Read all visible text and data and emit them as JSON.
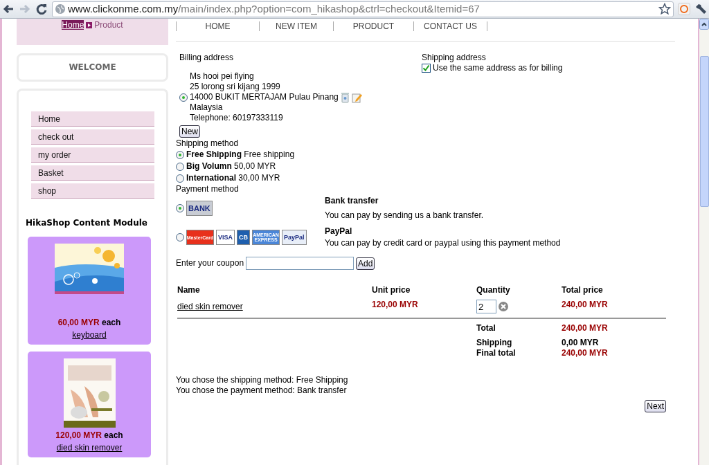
{
  "browser": {
    "url_host": "www.clickonme.com.my",
    "url_path": "/main/index.php?option=com_hikashop&ctrl=checkout&Itemid=67"
  },
  "breadcrumb": [
    {
      "label": "Home",
      "kind": "link"
    },
    {
      "label": "Product",
      "kind": "current"
    }
  ],
  "top_menu": [
    "HOME",
    "NEW ITEM",
    "PRODUCT",
    "CONTACT US"
  ],
  "sidebar": {
    "welcome": "WELCOME",
    "nav_items": [
      "Home",
      "check out",
      "my order",
      "Basket",
      "shop"
    ],
    "module_title": "HikaShop Content Module",
    "products": [
      {
        "price": "60,00 MYR",
        "unit": "each",
        "name": "keyboard",
        "kind": "flowers"
      },
      {
        "price": "120,00 MYR",
        "unit": "each",
        "name": "died skin remover",
        "kind": "leaflet"
      }
    ]
  },
  "billing": {
    "heading": "Billing address",
    "address": {
      "selected": true,
      "lines": [
        "Ms hooi pei flying",
        "25 lorong sri kijang 1999",
        "14000 BUKIT MERTAJAM Pulau Pinang",
        "Malaysia",
        "Telephone: 60197333119"
      ]
    },
    "new_button": "New"
  },
  "shipping_address": {
    "heading": "Shipping address",
    "same_as_billing": {
      "label": "Use the same address as for billing",
      "checked": true
    }
  },
  "shipping": {
    "heading": "Shipping method",
    "methods": [
      {
        "name": "Free Shipping",
        "detail": "Free shipping",
        "selected": true
      },
      {
        "name": "Big Volumn",
        "detail": "50,00 MYR",
        "selected": false
      },
      {
        "name": "International",
        "detail": "30,00 MYR",
        "selected": false
      }
    ]
  },
  "payment": {
    "heading": "Payment method",
    "methods": [
      {
        "title": "Bank transfer",
        "description": "You can pay by sending us a bank transfer.",
        "selected": true,
        "logos": [
          {
            "text": "BANK",
            "color": "#c8ccd4"
          }
        ]
      },
      {
        "title": "PayPal",
        "description": "You can pay by credit card or paypal using this payment method",
        "selected": false,
        "logos": [
          {
            "text": "MasterCard",
            "color": "#e8301c"
          },
          {
            "text": "VISA",
            "color": "#ffffff"
          },
          {
            "text": "CB",
            "color": "#1e5fae"
          },
          {
            "text": "AMERICAN EXPRESS",
            "color": "#4a86d8"
          },
          {
            "text": "PayPal",
            "color": "#e8eef8"
          }
        ]
      }
    ]
  },
  "coupon": {
    "label": "Enter your coupon",
    "button": "Add"
  },
  "cart": {
    "columns": [
      "Name",
      "Unit price",
      "Quantity",
      "Total price"
    ],
    "rows": [
      {
        "name": "died skin remover",
        "unit_price": "120,00 MYR",
        "quantity": "2",
        "total": "240,00 MYR"
      }
    ],
    "totals": [
      {
        "label": "Total",
        "value": "240,00 MYR",
        "emphasis": true
      },
      {
        "label": "Shipping",
        "value": "0,00 MYR",
        "emphasis": false
      },
      {
        "label": "Final total",
        "value": "240,00 MYR",
        "emphasis": true
      }
    ]
  },
  "summary": [
    "You chose the shipping method: Free Shipping",
    "You chose the payment method: Bank transfer"
  ],
  "next_button": "Next"
}
